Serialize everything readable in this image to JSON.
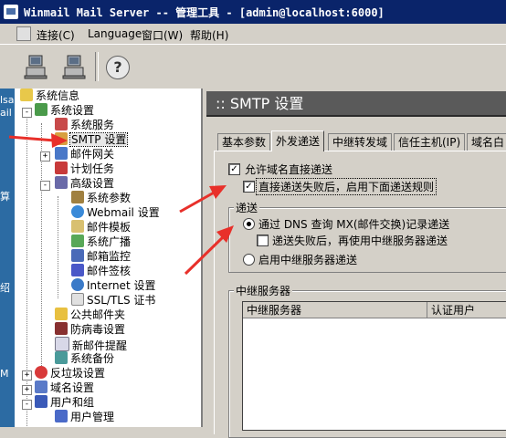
{
  "title_bar": {
    "text": "Winmail Mail Server -- 管理工具 - [admin@localhost:6000]"
  },
  "menu": {
    "items": [
      "连接(C)",
      "Language",
      "窗口(W)",
      "帮助(H)"
    ]
  },
  "toolbar": {
    "help_glyph": "?"
  },
  "desktop_strip": {
    "texts": [
      "lsa",
      "ail",
      "算",
      "绍",
      "M"
    ]
  },
  "tree": {
    "items": [
      {
        "label": "系统信息",
        "icon": "system-info-icon"
      },
      {
        "label": "系统设置",
        "icon": "system-settings-icon"
      },
      {
        "label": "系统服务",
        "icon": "system-service-icon"
      },
      {
        "label": "SMTP 设置",
        "icon": "smtp-icon"
      },
      {
        "label": "邮件网关",
        "icon": "mail-gateway-icon"
      },
      {
        "label": "计划任务",
        "icon": "scheduled-task-icon"
      },
      {
        "label": "高级设置",
        "icon": "advanced-settings-icon"
      },
      {
        "label": "系统参数",
        "icon": "system-params-icon"
      },
      {
        "label": "Webmail 设置",
        "icon": "webmail-icon"
      },
      {
        "label": "邮件模板",
        "icon": "mail-template-icon"
      },
      {
        "label": "系统广播",
        "icon": "broadcast-icon"
      },
      {
        "label": "邮箱监控",
        "icon": "mailbox-monitor-icon"
      },
      {
        "label": "邮件签核",
        "icon": "mail-approval-icon"
      },
      {
        "label": "Internet 设置",
        "icon": "internet-icon"
      },
      {
        "label": "SSL/TLS 证书",
        "icon": "certificate-icon"
      },
      {
        "label": "公共邮件夹",
        "icon": "public-folder-icon"
      },
      {
        "label": "防病毒设置",
        "icon": "antivirus-icon"
      },
      {
        "label": "新邮件提醒",
        "icon": "new-mail-alert-icon"
      },
      {
        "label": "系统备份",
        "icon": "backup-icon"
      },
      {
        "label": "反垃圾设置",
        "icon": "antispam-icon"
      },
      {
        "label": "域名设置",
        "icon": "domain-icon"
      },
      {
        "label": "用户和组",
        "icon": "users-groups-icon"
      },
      {
        "label": "用户管理",
        "icon": "user-manage-icon"
      }
    ]
  },
  "panel": {
    "title": ":: SMTP 设置"
  },
  "tabs": [
    "基本参数",
    "外发递送",
    "中继转发域",
    "信任主机(IP)",
    "域名白"
  ],
  "options": {
    "allow_direct": "允许域名直接递送",
    "fallback_rules": "直接递送失败后，启用下面递送规则"
  },
  "delivery_group": {
    "legend": "递送",
    "radio_dns": "通过 DNS 查询 MX(邮件交换)记录递送",
    "relay_fallback": "递送失败后，再使用中继服务器递送",
    "radio_relay": "启用中继服务器递送"
  },
  "relay_group": {
    "legend": "中继服务器",
    "columns": [
      "中继服务器",
      "认证用户"
    ]
  },
  "colors": {
    "titlebar": "#0a246a",
    "arrow": "#e8302a",
    "panel_title": "#5a5a5a"
  }
}
